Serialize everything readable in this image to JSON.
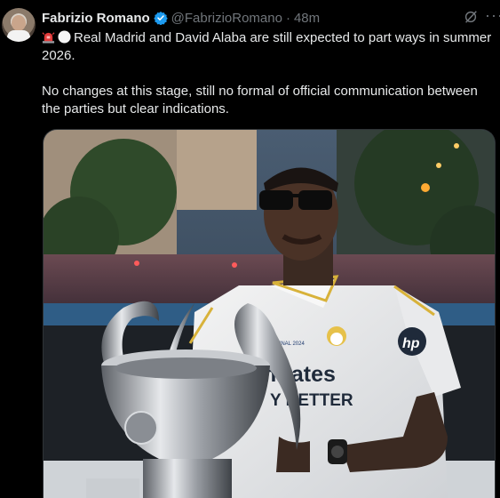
{
  "author": {
    "name": "Fabrizio Romano",
    "handle": "@FabrizioRomano",
    "separator": "·",
    "time": "48m"
  },
  "icons": {
    "verified": "verified-badge-icon",
    "grok": "grok-icon",
    "more": "more-icon",
    "siren": "siren-emoji",
    "white_circle": "white-circle-emoji"
  },
  "tweet": {
    "line1": "Real Madrid and David Alaba are still expected to part ways in summer 2026.",
    "line2": "No changes at this stage, still no formal of official communication between the parties but clear indications."
  },
  "media": {
    "shirt_sponsor_line1": "mirates",
    "shirt_sponsor_line2": "Y BETTER",
    "shirt_patch": "FINAL 2024",
    "sleeve_text": "hp"
  },
  "colors": {
    "background": "#000000",
    "text": "#e7e9ea",
    "muted": "#71767b",
    "verified": "#1d9bf0"
  }
}
